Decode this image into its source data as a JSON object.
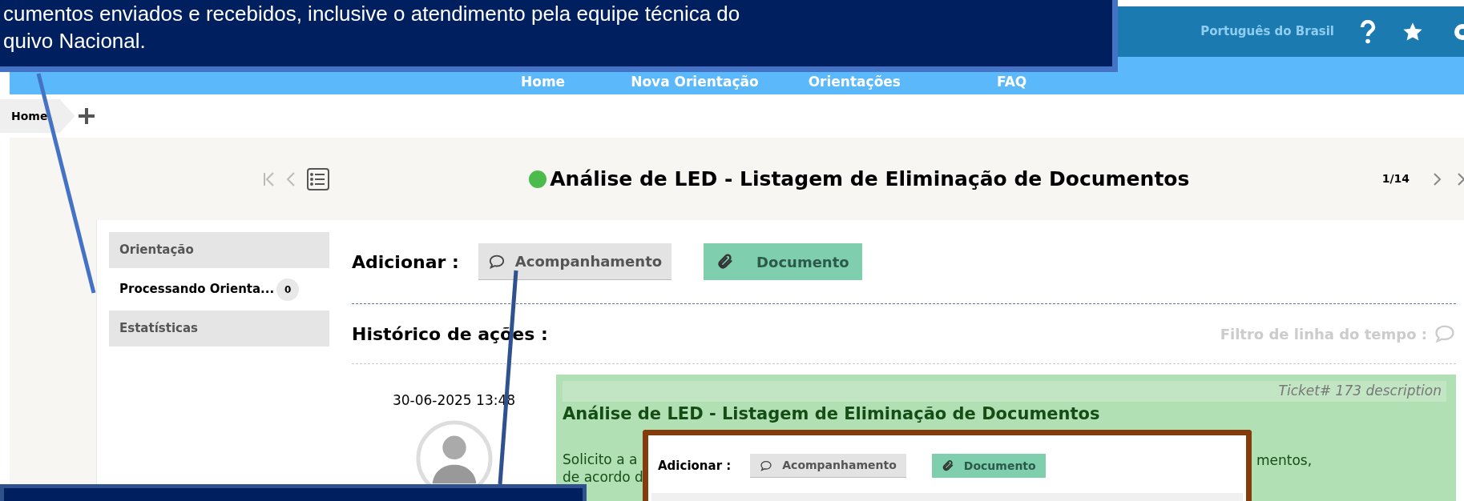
{
  "callout": {
    "lines": [
      "cumentos enviados e recebidos, inclusive o atendimento pela equipe técnica do",
      "quivo Nacional."
    ]
  },
  "top_bar": {
    "language": "Português do Brasil"
  },
  "nav": [
    "Home",
    "Nova Orientação",
    "Orientações",
    "FAQ"
  ],
  "breadcrumb": {
    "items": [
      "Home"
    ]
  },
  "ticket_header": {
    "title": "Análise de LED - Listagem de Eliminação de Documentos",
    "position": "1/14"
  },
  "sidebar": {
    "items": [
      {
        "label": "Orientação",
        "selected": false
      },
      {
        "label": "Processando Orienta...",
        "selected": true,
        "count": "0"
      },
      {
        "label": "Estatísticas",
        "selected": false
      }
    ]
  },
  "add_bar": {
    "label": "Adicionar :",
    "buttons": [
      {
        "kind": "comment",
        "label": "Acompanhamento"
      },
      {
        "kind": "attachment",
        "label": "Documento"
      }
    ]
  },
  "history": {
    "title": "Histórico de ações :",
    "filter_label": "Filtro de linha do tempo :"
  },
  "entry": {
    "time": "30-06-2025 13:48",
    "tag": "Ticket# 173 description",
    "subject": "Análise de LED - Listagem de Eliminação de Documentos",
    "body_left": [
      "Solicito a a",
      "de acordo d"
    ],
    "body_right": [
      "mentos,"
    ]
  },
  "inset": {
    "label": "Adicionar :",
    "buttons": [
      {
        "kind": "comment",
        "label": "Acompanhamento"
      },
      {
        "kind": "attachment",
        "label": "Documento"
      }
    ]
  }
}
